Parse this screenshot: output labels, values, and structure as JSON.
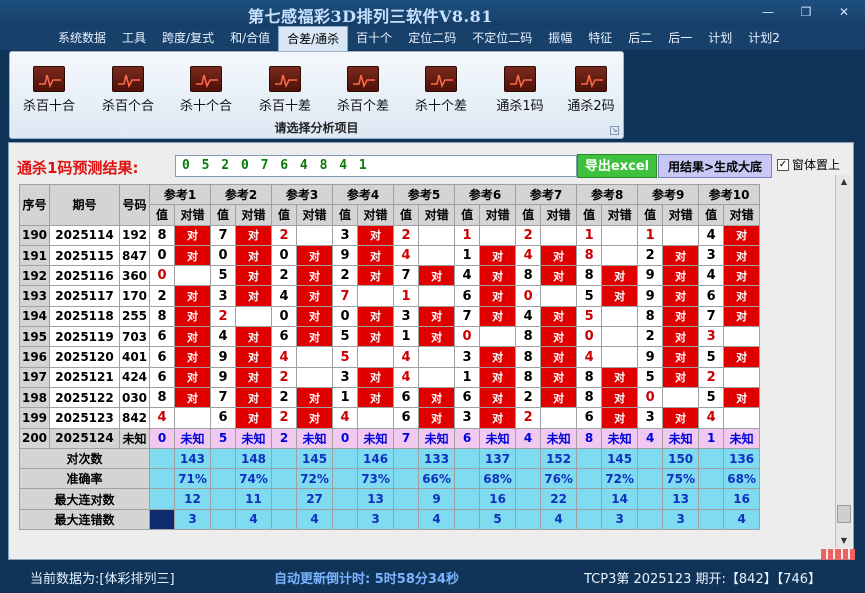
{
  "window": {
    "title": "第七感福彩3D排列三软件V8.81",
    "controls": [
      "minimize-icon",
      "restore-icon",
      "close-icon"
    ]
  },
  "menu": [
    "系统数据",
    "工具",
    "跨度/复式",
    "和/合值",
    "合差/通杀",
    "百十个",
    "定位二码",
    "不定位二码",
    "振幅",
    "特征",
    "后二",
    "后一",
    "计划",
    "计划2"
  ],
  "menu_active": "合差/通杀",
  "ribbon": {
    "buttons": [
      "杀百十合",
      "杀百个合",
      "杀十个合",
      "杀百十差",
      "杀百个差",
      "杀十个差",
      "通杀1码",
      "通杀2码"
    ],
    "caption": "请选择分析项目"
  },
  "prediction": {
    "label": "通杀1码预测结果:",
    "value": "0 5 2 0 7 6 4 8 4 1",
    "export_button": "导出excel",
    "generate_button": "用结果>生成大底",
    "topmost_checkbox": "窗体置上",
    "topmost_checked": true
  },
  "table": {
    "col_seq": "序号",
    "col_period": "期号",
    "col_number": "号码",
    "ref_headers": [
      "参考1",
      "参考2",
      "参考3",
      "参考4",
      "参考5",
      "参考6",
      "参考7",
      "参考8",
      "参考9",
      "参考10"
    ],
    "sub_value": "值",
    "sub_match": "对错",
    "match_text": "对",
    "rows": [
      {
        "seq": "190",
        "period": "2025114",
        "num": "192",
        "vals": [
          "8",
          "7",
          "2",
          "3",
          "2",
          "1",
          "2",
          "1",
          "1",
          "4"
        ],
        "hits": [
          1,
          1,
          0,
          1,
          0,
          0,
          0,
          0,
          0,
          1
        ],
        "red": [
          0,
          0,
          1,
          0,
          1,
          1,
          1,
          1,
          1,
          0
        ]
      },
      {
        "seq": "191",
        "period": "2025115",
        "num": "847",
        "vals": [
          "0",
          "0",
          "0",
          "9",
          "4",
          "1",
          "4",
          "8",
          "2",
          "3"
        ],
        "hits": [
          1,
          1,
          1,
          1,
          0,
          1,
          1,
          0,
          1,
          1
        ],
        "red": [
          0,
          0,
          0,
          0,
          1,
          0,
          1,
          1,
          0,
          0
        ]
      },
      {
        "seq": "192",
        "period": "2025116",
        "num": "360",
        "vals": [
          "0",
          "5",
          "2",
          "2",
          "7",
          "4",
          "8",
          "8",
          "9",
          "4"
        ],
        "hits": [
          0,
          1,
          1,
          1,
          1,
          1,
          1,
          1,
          1,
          1
        ],
        "red": [
          1,
          0,
          0,
          0,
          0,
          0,
          0,
          0,
          0,
          0
        ]
      },
      {
        "seq": "193",
        "period": "2025117",
        "num": "170",
        "vals": [
          "2",
          "3",
          "4",
          "7",
          "1",
          "6",
          "0",
          "5",
          "9",
          "6"
        ],
        "hits": [
          1,
          1,
          1,
          0,
          0,
          1,
          0,
          1,
          1,
          1
        ],
        "red": [
          0,
          0,
          0,
          1,
          1,
          0,
          1,
          0,
          0,
          0
        ]
      },
      {
        "seq": "194",
        "period": "2025118",
        "num": "255",
        "vals": [
          "8",
          "2",
          "0",
          "0",
          "3",
          "7",
          "4",
          "5",
          "8",
          "7"
        ],
        "hits": [
          1,
          0,
          1,
          1,
          1,
          1,
          1,
          0,
          1,
          1
        ],
        "red": [
          0,
          1,
          0,
          0,
          0,
          0,
          0,
          1,
          0,
          0
        ]
      },
      {
        "seq": "195",
        "period": "2025119",
        "num": "703",
        "vals": [
          "6",
          "4",
          "6",
          "5",
          "1",
          "0",
          "8",
          "0",
          "2",
          "3"
        ],
        "hits": [
          1,
          1,
          1,
          1,
          1,
          0,
          1,
          0,
          1,
          0
        ],
        "red": [
          0,
          0,
          0,
          0,
          0,
          1,
          0,
          1,
          0,
          1
        ]
      },
      {
        "seq": "196",
        "period": "2025120",
        "num": "401",
        "vals": [
          "6",
          "9",
          "4",
          "5",
          "4",
          "3",
          "8",
          "4",
          "9",
          "5"
        ],
        "hits": [
          1,
          1,
          0,
          0,
          0,
          1,
          1,
          0,
          1,
          1
        ],
        "red": [
          0,
          0,
          1,
          1,
          1,
          0,
          0,
          1,
          0,
          0
        ]
      },
      {
        "seq": "197",
        "period": "2025121",
        "num": "424",
        "vals": [
          "6",
          "9",
          "2",
          "3",
          "4",
          "1",
          "8",
          "8",
          "5",
          "2"
        ],
        "hits": [
          1,
          1,
          0,
          1,
          0,
          1,
          1,
          1,
          1,
          0
        ],
        "red": [
          0,
          0,
          1,
          0,
          1,
          0,
          0,
          0,
          0,
          1
        ]
      },
      {
        "seq": "198",
        "period": "2025122",
        "num": "030",
        "vals": [
          "8",
          "7",
          "2",
          "1",
          "6",
          "6",
          "2",
          "8",
          "0",
          "5"
        ],
        "hits": [
          1,
          1,
          1,
          1,
          1,
          1,
          1,
          1,
          0,
          1
        ],
        "red": [
          0,
          0,
          0,
          0,
          0,
          0,
          0,
          0,
          1,
          0
        ]
      },
      {
        "seq": "199",
        "period": "2025123",
        "num": "842",
        "vals": [
          "4",
          "6",
          "2",
          "4",
          "6",
          "3",
          "2",
          "6",
          "3",
          "4"
        ],
        "hits": [
          0,
          1,
          1,
          0,
          1,
          1,
          0,
          1,
          1,
          0
        ],
        "red": [
          1,
          0,
          1,
          1,
          0,
          0,
          1,
          0,
          0,
          1
        ]
      }
    ],
    "unknown_row": {
      "seq": "200",
      "period": "2025124",
      "num": "未知",
      "vals": [
        "0",
        "5",
        "2",
        "0",
        "7",
        "6",
        "4",
        "8",
        "4",
        "1"
      ],
      "status": "未知"
    },
    "stats": [
      {
        "label": "对次数",
        "values": [
          "143",
          "148",
          "145",
          "146",
          "133",
          "137",
          "152",
          "145",
          "150",
          "136"
        ]
      },
      {
        "label": "准确率",
        "values": [
          "71%",
          "74%",
          "72%",
          "73%",
          "66%",
          "68%",
          "76%",
          "72%",
          "75%",
          "68%"
        ]
      },
      {
        "label": "最大连对数",
        "values": [
          "12",
          "11",
          "27",
          "13",
          "9",
          "16",
          "22",
          "14",
          "13",
          "16"
        ]
      },
      {
        "label": "最大连错数",
        "values": [
          "3",
          "4",
          "4",
          "3",
          "4",
          "5",
          "4",
          "3",
          "3",
          "4"
        ]
      }
    ]
  },
  "status": {
    "current_data": "当前数据为:[体彩排列三]",
    "countdown": "自动更新倒计时: 5时58分34秒",
    "draw_info": "TCP3第 2025123 期开:【842】【746】"
  },
  "colors": {
    "hit": "#e00000",
    "unknown_row": "#f0c8f0",
    "stats": "#7fdcf0",
    "prediction": "#0a7a0a",
    "label_red": "#e01010"
  }
}
